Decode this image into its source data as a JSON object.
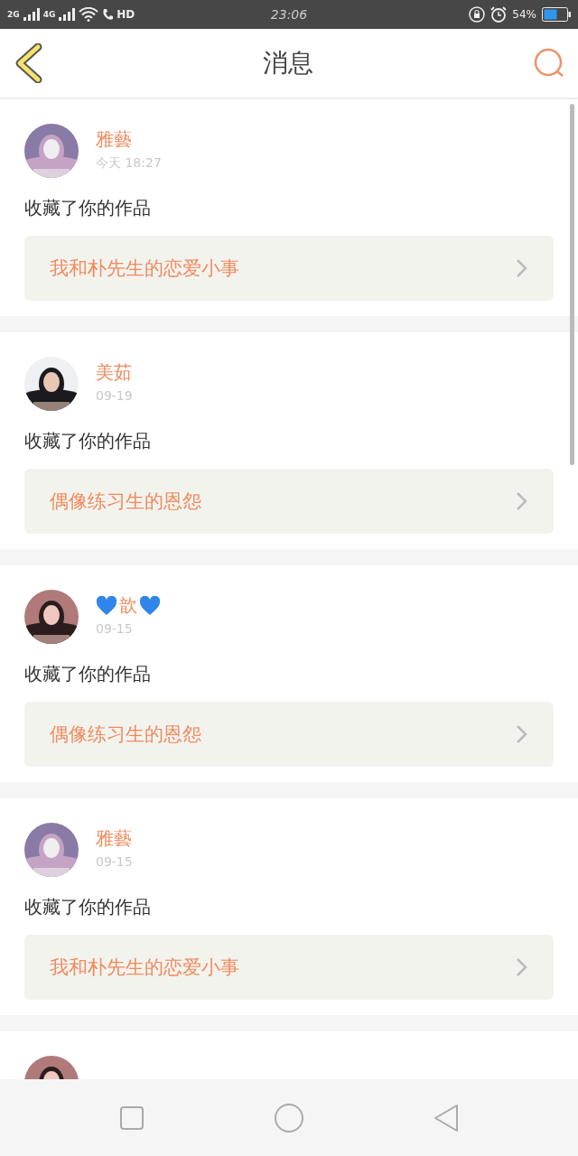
{
  "status_bar": {
    "network_1": "2G",
    "network_2": "4G",
    "call_badge": "HD",
    "time": "23:06",
    "battery": "54%"
  },
  "header": {
    "title": "消息"
  },
  "messages": [
    {
      "name": "雅藝",
      "time": "今天 18:27",
      "text": "收藏了你的作品",
      "work": "我和朴先生的恋爱小事",
      "hearts": false
    },
    {
      "name": "美茹",
      "time": "09-19",
      "text": "收藏了你的作品",
      "work": "偶像练习生的恩怨",
      "hearts": false
    },
    {
      "name": "歆",
      "time": "09-15",
      "text": "收藏了你的作品",
      "work": "偶像练习生的恩怨",
      "hearts": true
    },
    {
      "name": "雅藝",
      "time": "09-15",
      "text": "收藏了你的作品",
      "work": "我和朴先生的恋爱小事",
      "hearts": false
    }
  ]
}
